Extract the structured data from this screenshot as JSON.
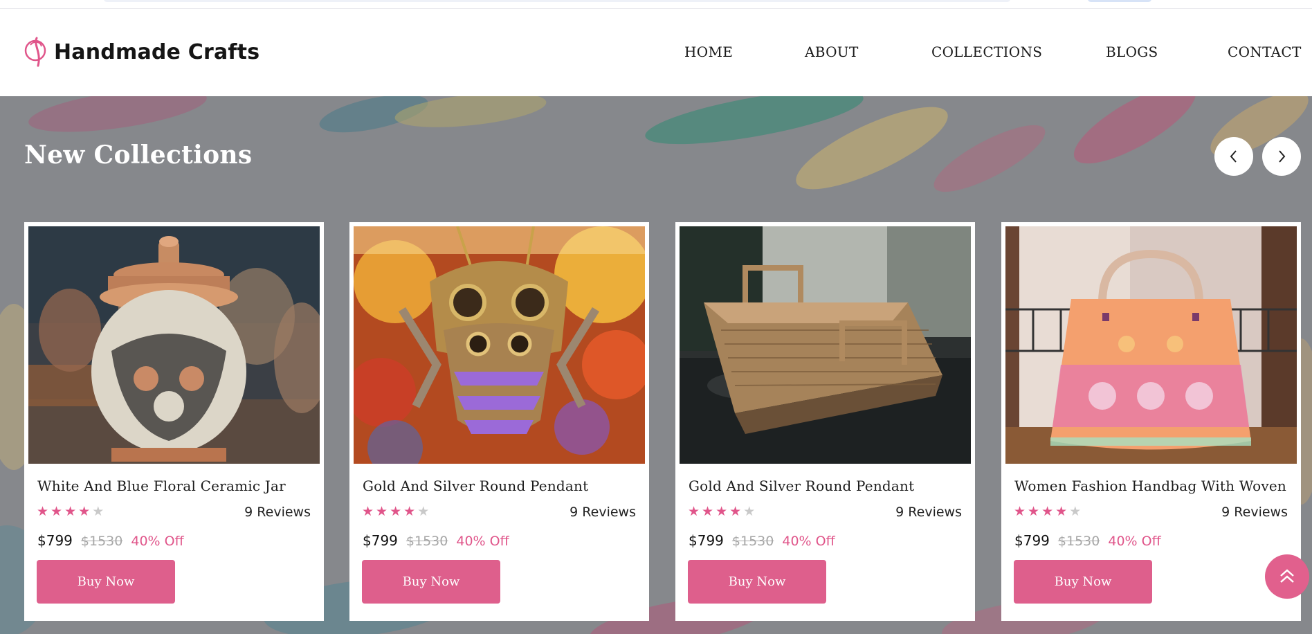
{
  "brand": {
    "name": "Handmade Crafts",
    "accent": "#de5f8c"
  },
  "nav": {
    "home": "HOME",
    "about": "ABOUT",
    "collections": "COLLECTIONS",
    "blogs": "BLOGS",
    "contact": "CONTACT"
  },
  "section": {
    "title": "New Collections",
    "prev_icon": "chevron-left-icon",
    "next_icon": "chevron-right-icon"
  },
  "products": [
    {
      "title": "White And Blue Floral Ceramic Jar",
      "rating": 4,
      "max_rating": 5,
      "reviews": "9 Reviews",
      "price": "$799",
      "old_price": "$1530",
      "discount": "40% Off",
      "button": "Buy Now"
    },
    {
      "title": "Gold And Silver Round Pendant",
      "rating": 4,
      "max_rating": 5,
      "reviews": "9 Reviews",
      "price": "$799",
      "old_price": "$1530",
      "discount": "40% Off",
      "button": "Buy Now"
    },
    {
      "title": "Gold And Silver Round Pendant",
      "rating": 4,
      "max_rating": 5,
      "reviews": "9 Reviews",
      "price": "$799",
      "old_price": "$1530",
      "discount": "40% Off",
      "button": "Buy Now"
    },
    {
      "title": "Women Fashion Handbag With Woven",
      "rating": 4,
      "max_rating": 5,
      "reviews": "9 Reviews",
      "price": "$799",
      "old_price": "$1530",
      "discount": "40% Off",
      "button": "Buy Now"
    }
  ],
  "scroll_top_icon": "double-chevron-up-icon"
}
